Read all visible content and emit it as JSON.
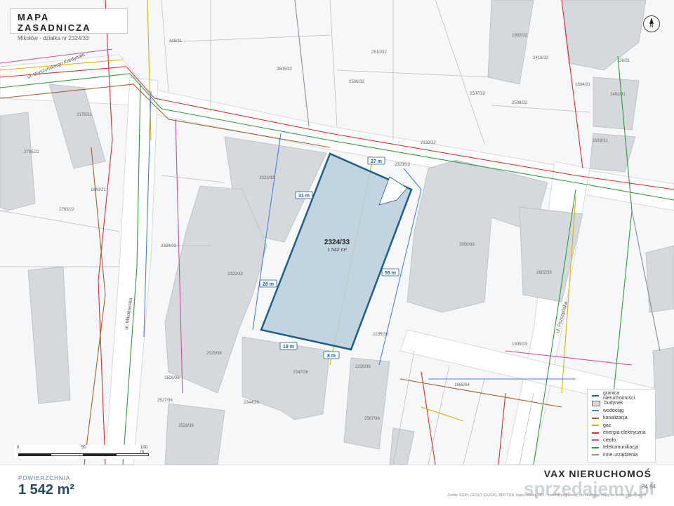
{
  "header": {
    "title": "MAPA ZASADNICZA",
    "subtitle": "Mikołów · działka nr 2324/33"
  },
  "north": {
    "label": "N"
  },
  "plot": {
    "id": "2324/33",
    "area": "1 542 m²",
    "dimensions": [
      "27 m",
      "31 m",
      "55 m",
      "28 m",
      "19 m",
      "8 m"
    ]
  },
  "streets": [
    "ul. Wyszyńskiego Kardynała",
    "ul. Mikołowska",
    "ul. Pszczyńska"
  ],
  "parcel_labels": [
    "448/31",
    "2505/32",
    "2510/32",
    "2506/32",
    "2507/32",
    "2508/32",
    "1992/32",
    "2419/32",
    "136/31",
    "1834/31",
    "1492/31",
    "2176/31",
    "2785/22",
    "2763/22",
    "1860/21",
    "2321/33",
    "2320/33",
    "2322/33",
    "2323/33",
    "2132/32",
    "2050/33",
    "2602/33",
    "1919/31",
    "2235/33",
    "2239/36",
    "2347/36",
    "2344/36",
    "1668/34",
    "1935/33",
    "2587/36",
    "2525/36",
    "2526/36",
    "2527/36",
    "2528/36"
  ],
  "legend": {
    "items": [
      {
        "label": "granica nieruchomości",
        "color": "#1f5f86",
        "kind": "line"
      },
      {
        "label": "budynek",
        "color": "#d5d8dc",
        "kind": "box"
      },
      {
        "label": "wodociąg",
        "color": "#4a7fd4",
        "kind": "line"
      },
      {
        "label": "kanalizacja",
        "color": "#a0602e",
        "kind": "line"
      },
      {
        "label": "gaz",
        "color": "#d9b400",
        "kind": "line"
      },
      {
        "label": "energia elektryczna",
        "color": "#d8322e",
        "kind": "line"
      },
      {
        "label": "ciepło",
        "color": "#cc4f9d",
        "kind": "line"
      },
      {
        "label": "telekomunikacja",
        "color": "#2e9a3e",
        "kind": "line"
      },
      {
        "label": "inne urządzenia",
        "color": "#8a8f95",
        "kind": "line"
      }
    ]
  },
  "scale": {
    "labels": [
      "0",
      "50",
      "100 m"
    ]
  },
  "footer": {
    "area_label": "POWIERZCHNIA",
    "area_value": "1 542 m²",
    "brand": "VAX NIERUCHOMOŚ",
    "watermark": "sprzedajemy.pl",
    "phone": "84 84",
    "source": "Źródło: EGiB i GESUT (GUGiK), BDOT10k, kopia lokalna VAX · materiał poglądowy, nie zastępuje mapy do celów projektowych"
  },
  "colors": {
    "plot_fill": "#b9cedc",
    "plot_border": "#1f5f86",
    "building": "#d5d8dc",
    "accent": "#234a64"
  }
}
